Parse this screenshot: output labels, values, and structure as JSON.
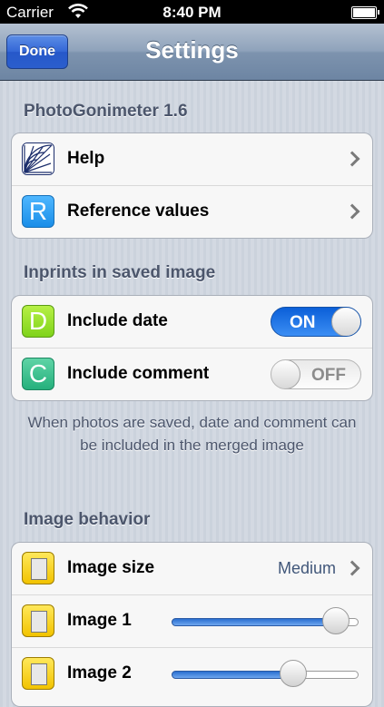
{
  "status_bar": {
    "carrier": "Carrier",
    "time": "8:40 PM"
  },
  "nav": {
    "title": "Settings",
    "done_label": "Done"
  },
  "sections": {
    "app": {
      "header": "PhotoGonimeter 1.6",
      "rows": [
        {
          "label": "Help",
          "icon": "protractor-icon"
        },
        {
          "label": "Reference values",
          "icon": "letter-r-icon",
          "icon_letter": "R"
        }
      ]
    },
    "inprints": {
      "header": "Inprints in saved image",
      "rows": [
        {
          "label": "Include date",
          "icon_letter": "D",
          "toggle": "ON",
          "state": true
        },
        {
          "label": "Include comment",
          "icon_letter": "C",
          "toggle": "OFF",
          "state": false
        }
      ],
      "footer": "When photos are saved, date and comment can be included in the merged image"
    },
    "image_behavior": {
      "header": "Image behavior",
      "rows": [
        {
          "label": "Image size",
          "value": "Medium"
        },
        {
          "label": "Image 1",
          "slider": 0.88
        },
        {
          "label": "Image 2",
          "slider": 0.65
        }
      ]
    }
  },
  "colors": {
    "nav_accent": "#3366d6",
    "toggle_on": "#1f6fe0",
    "section_text": "#4c566c"
  }
}
